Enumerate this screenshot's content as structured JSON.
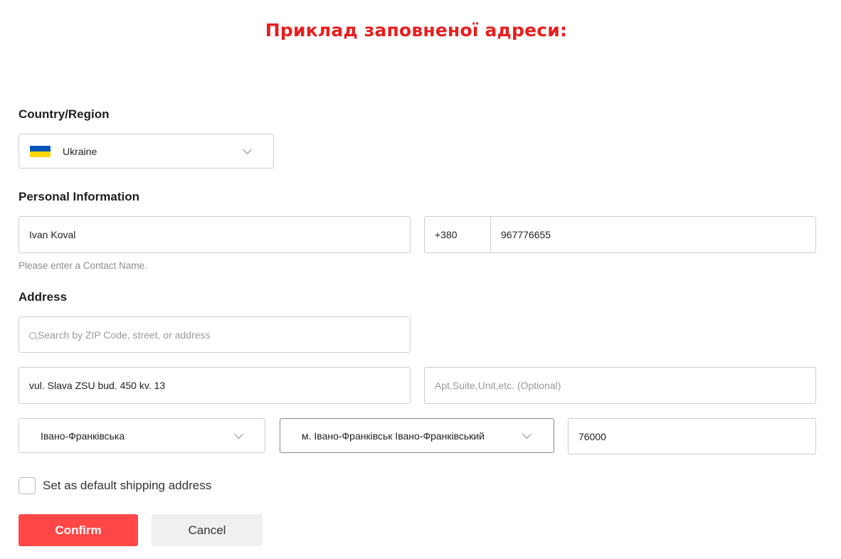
{
  "banner": {
    "title": "Приклад заповненої адреси:",
    "color": "#e81e1e"
  },
  "country_section": {
    "label": "Country/Region",
    "selected": "Ukraine",
    "flag_icon": "ukraine-flag-icon",
    "flag_colors": [
      "#0057b7",
      "#ffd700"
    ]
  },
  "personal_section": {
    "label": "Personal Information",
    "contact_name": "Ivan Koval",
    "phone_code": "+380",
    "phone_number": "967776655",
    "hint": "Please enter a Contact Name."
  },
  "address_section": {
    "label": "Address",
    "search_placeholder": "Search by ZIP Code, street, or address",
    "street": "vul. Slava ZSU bud. 450 kv. 13",
    "apt_placeholder": "Apt,Suite,Unit,etc.  (Optional)",
    "region": "Івано-Франківська",
    "city": "м. Івано-Франківськ Івано-Франківський",
    "zip": "76000"
  },
  "default_checkbox": {
    "label": "Set as default shipping address",
    "checked": false
  },
  "buttons": {
    "confirm": "Confirm",
    "cancel": "Cancel",
    "accent": "#ff4747"
  }
}
